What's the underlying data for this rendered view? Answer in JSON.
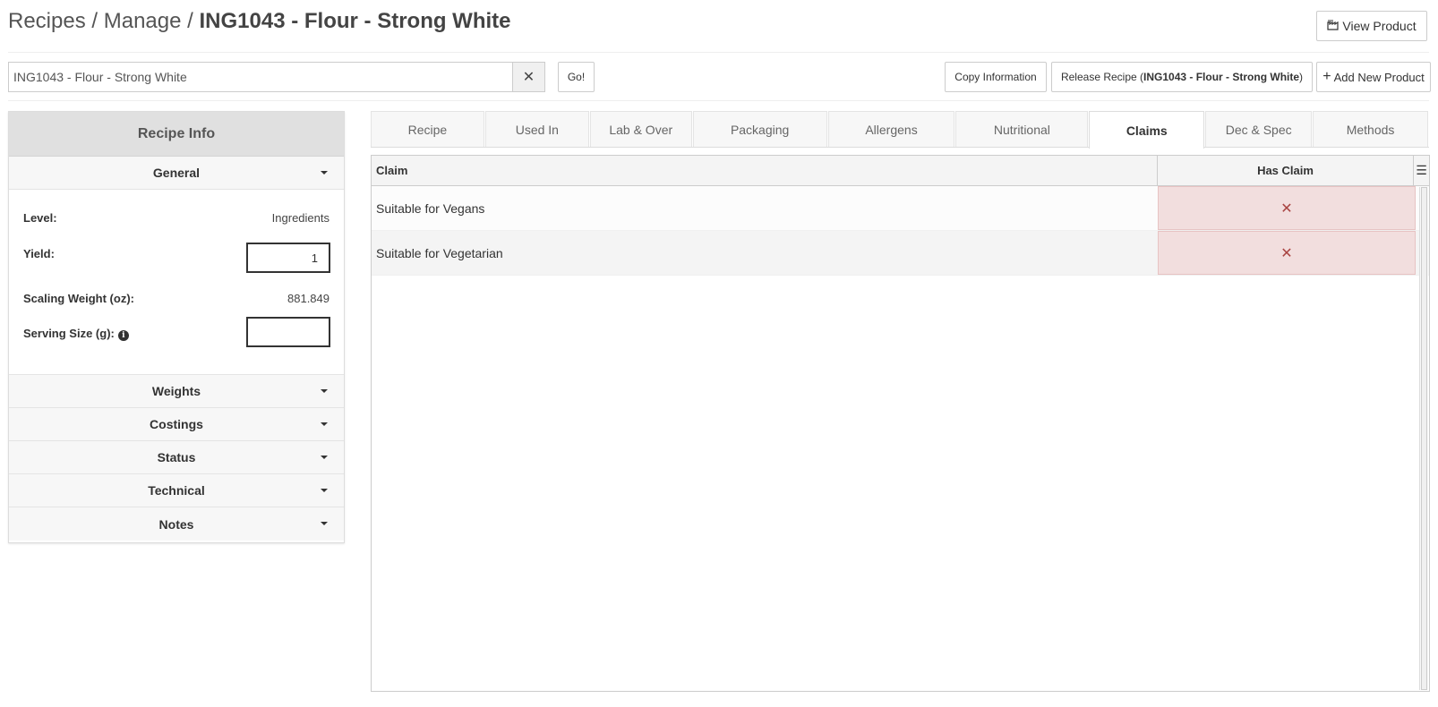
{
  "header": {
    "crumb_root": "Recipes",
    "crumb_sep": "/",
    "crumb_section": "Manage",
    "crumb_current": "ING1043 - Flour - Strong White",
    "view_product_label": "View Product",
    "view_product_icon": "factory-icon"
  },
  "search": {
    "value": "ING1043 - Flour - Strong White",
    "clear_icon": "close-icon",
    "go_label": "Go!"
  },
  "toolbar": {
    "copy_label": "Copy Information",
    "release_prefix": "Release Recipe (",
    "release_name": "ING1043 - Flour - Strong White",
    "release_suffix": ")",
    "add_label": "Add New Product"
  },
  "sidebar": {
    "title": "Recipe Info",
    "general": {
      "label": "General",
      "level_label": "Level:",
      "level_value": "Ingredients",
      "yield_label": "Yield:",
      "yield_value": "1",
      "scaling_label": "Scaling Weight (oz):",
      "scaling_value": "881.849",
      "serving_label": "Serving Size (g):",
      "serving_value": ""
    },
    "sections": [
      "Weights",
      "Costings",
      "Status",
      "Technical",
      "Notes"
    ]
  },
  "tabs": [
    {
      "label": "Recipe",
      "active": false
    },
    {
      "label": "Used In",
      "active": false
    },
    {
      "label": "Lab & Over",
      "active": false
    },
    {
      "label": "Packaging",
      "active": false
    },
    {
      "label": "Allergens",
      "active": false
    },
    {
      "label": "Nutritional",
      "active": false
    },
    {
      "label": "Claims",
      "active": true
    },
    {
      "label": "Dec & Spec",
      "active": false
    },
    {
      "label": "Methods",
      "active": false
    }
  ],
  "grid": {
    "columns": [
      "Claim",
      "Has Claim"
    ],
    "rows": [
      {
        "claim": "Suitable for Vegans",
        "has_claim": "✕"
      },
      {
        "claim": "Suitable for Vegetarian",
        "has_claim": "✕"
      }
    ]
  },
  "colors": {
    "no_claim_bg": "#f2dede",
    "no_claim_mark": "#a94442"
  }
}
